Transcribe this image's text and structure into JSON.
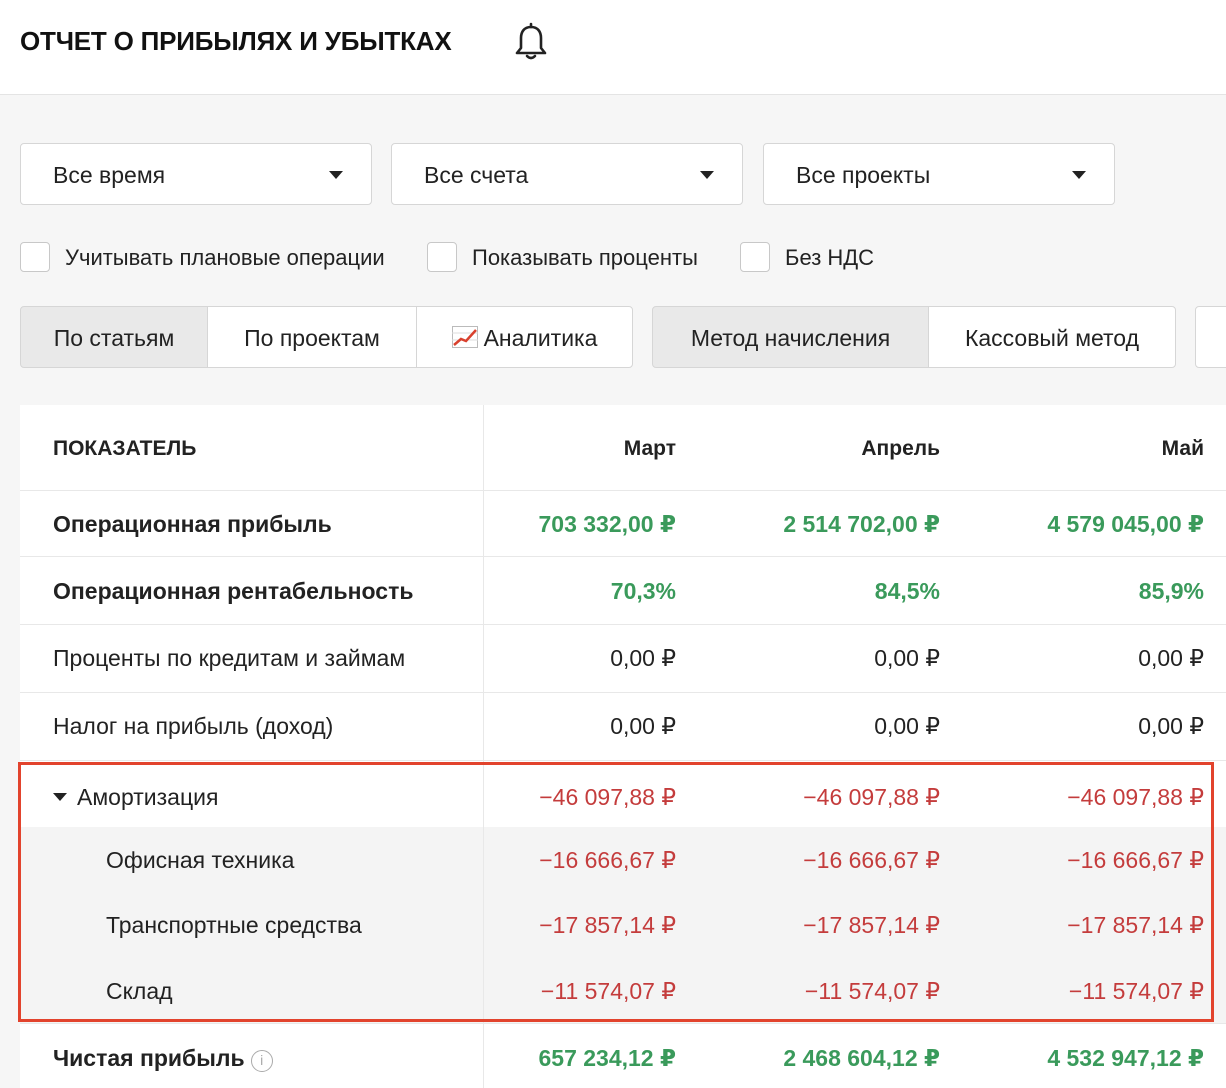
{
  "header": {
    "title": "ОТЧЕТ О ПРИБЫЛЯХ И УБЫТКАХ",
    "bell_icon": "bell-icon"
  },
  "filters": {
    "period": "Все время",
    "accounts": "Все счета",
    "projects": "Все проекты"
  },
  "options": {
    "planned": "Учитывать плановые операции",
    "percent": "Показывать проценты",
    "no_vat": "Без НДС"
  },
  "views": {
    "by_items": "По статьям",
    "by_projects": "По проектам",
    "analytics": "Аналитика",
    "analytics_icon": "chart-line-icon",
    "accrual": "Метод начисления",
    "cash": "Кассовый метод"
  },
  "colors": {
    "positive": "#3a9a5b",
    "negative": "#c43c3c",
    "highlight": "#e2432d"
  },
  "table": {
    "headers": [
      "ПОКАЗАТЕЛЬ",
      "Март",
      "Апрель",
      "Май"
    ],
    "rows": [
      {
        "label": "Операционная прибыль",
        "values": [
          "703 332,00 ₽",
          "2 514 702,00 ₽",
          "4 579 045,00 ₽"
        ]
      },
      {
        "label": "Операционная рентабельность",
        "values": [
          "70,3%",
          "84,5%",
          "85,9%"
        ]
      },
      {
        "label": "Проценты по кредитам и займам",
        "values": [
          "0,00 ₽",
          "0,00 ₽",
          "0,00 ₽"
        ]
      },
      {
        "label": "Налог на прибыль (доход)",
        "values": [
          "0,00 ₽",
          "0,00 ₽",
          "0,00 ₽"
        ]
      },
      {
        "label": "Амортизация",
        "values": [
          "−46 097,88 ₽",
          "−46 097,88 ₽",
          "−46 097,88 ₽"
        ]
      },
      {
        "label": "Офисная техника",
        "values": [
          "−16 666,67 ₽",
          "−16 666,67 ₽",
          "−16 666,67 ₽"
        ]
      },
      {
        "label": "Транспортные средства",
        "values": [
          "−17 857,14 ₽",
          "−17 857,14 ₽",
          "−17 857,14 ₽"
        ]
      },
      {
        "label": "Склад",
        "values": [
          "−11 574,07 ₽",
          "−11 574,07 ₽",
          "−11 574,07 ₽"
        ]
      },
      {
        "label": "Чистая прибыль",
        "values": [
          "657 234,12 ₽",
          "2 468 604,12 ₽",
          "4 532 947,12 ₽"
        ],
        "info_icon": "i"
      }
    ]
  }
}
